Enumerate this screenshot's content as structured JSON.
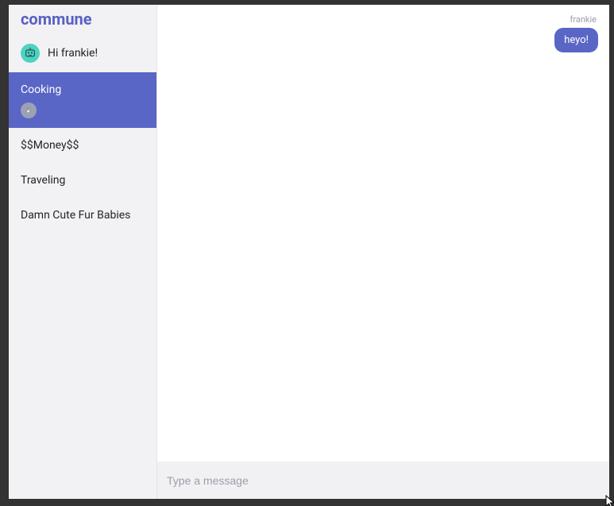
{
  "brand": "commune",
  "direct_message": {
    "text": "Hi frankie!"
  },
  "channels": [
    {
      "name": "Cooking",
      "active": true,
      "has_members": true
    },
    {
      "name": "$$Money$$",
      "active": false
    },
    {
      "name": "Traveling",
      "active": false
    },
    {
      "name": "Damn Cute Fur Babies",
      "active": false
    }
  ],
  "chat": {
    "messages": [
      {
        "user": "frankie",
        "text": "heyo!"
      }
    ]
  },
  "compose": {
    "placeholder": "Type a message"
  }
}
